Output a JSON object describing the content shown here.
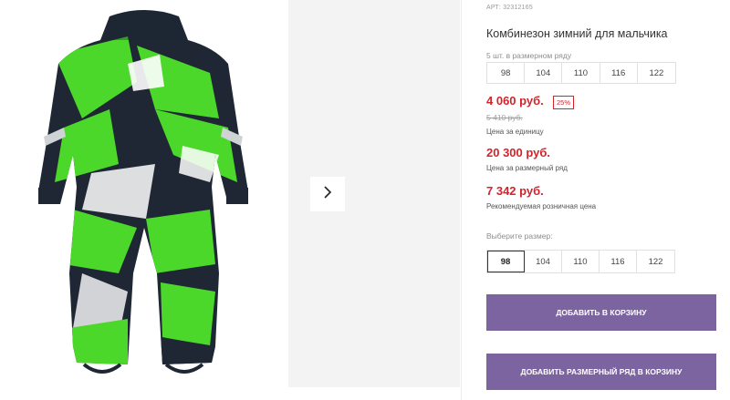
{
  "product": {
    "article": "АРТ: 32312165",
    "title": "Комбинезон зимний для мальчика",
    "pack_label": "5 шт. в размерном ряду",
    "pack_sizes": [
      "98",
      "104",
      "110",
      "116",
      "122"
    ],
    "unit_price": "4 060 руб.",
    "discount": "25%",
    "old_price": "5 410 руб.",
    "unit_price_caption": "Цена за единицу",
    "pack_price": "20 300 руб.",
    "pack_price_caption": "Цена за размерный ряд",
    "retail_price": "7 342 руб.",
    "retail_price_caption": "Рекомендуемая розничная цена",
    "choose_size_label": "Выберите размер:",
    "sizes": [
      "98",
      "104",
      "110",
      "116",
      "122"
    ],
    "selected_size": "98"
  },
  "buttons": {
    "add_to_cart": "ДОБАВИТЬ В КОРЗИНУ",
    "add_pack_to_cart": "ДОБАВИТЬ РАЗМЕРНЫЙ РЯД В КОРЗИНУ"
  },
  "colors": {
    "price_red": "#d4232b",
    "button_purple": "#7c64a0",
    "garment_green": "#4cd82a",
    "garment_navy": "#1e2733"
  },
  "icons": {
    "next": "chevron-right-icon"
  }
}
